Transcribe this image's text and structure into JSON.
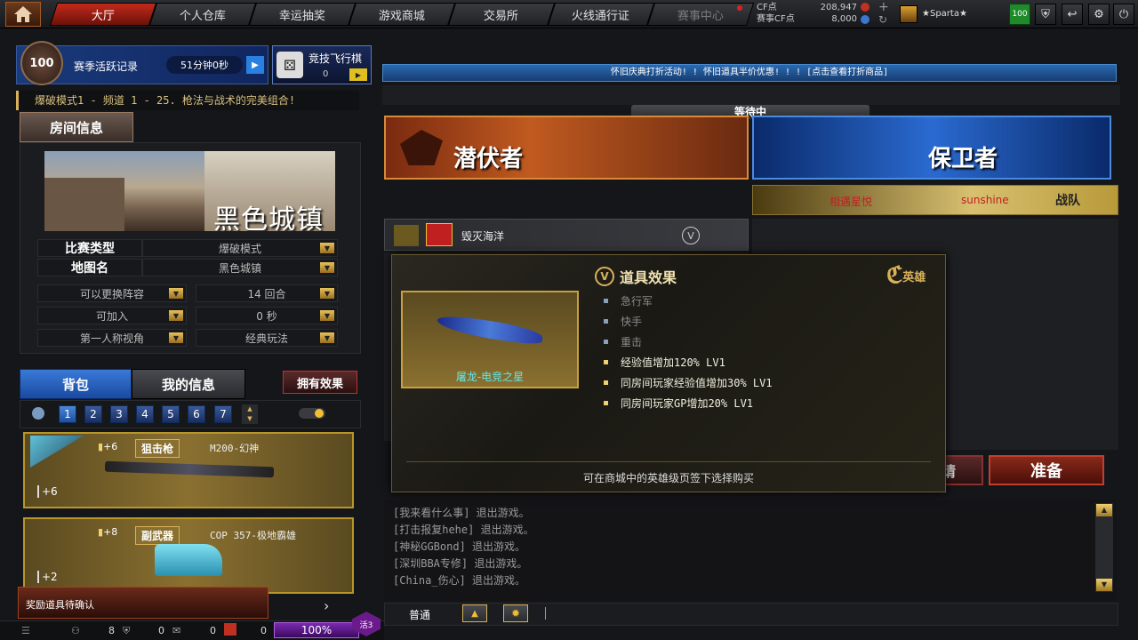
{
  "nav": {
    "tabs": [
      "大厅",
      "个人仓库",
      "幸运抽奖",
      "游戏商城",
      "交易所",
      "火线通行证",
      "赛事中心"
    ]
  },
  "currency": {
    "cf_label": "CF点",
    "cf_value": "208,947",
    "race_label": "赛事CF点",
    "race_value": "8,000"
  },
  "player": {
    "name": "★Sparta★",
    "level": "100"
  },
  "season": {
    "rank": "100",
    "title": "赛季活跃记录",
    "time": "51分钟0秒",
    "chess_title": "竞技飞行棋",
    "chess_count": "0"
  },
  "marquee_left": "爆破模式1 - 频道 1 - 25. 枪法与战术的完美组合!",
  "marquee_right": "怀旧庆典打折活动! ! 怀旧道具半价优惠! ! ! [点击查看打折商品]",
  "room": {
    "header": "房间信息",
    "map_name_overlay": "黑色城镇",
    "match_type_label": "比赛类型",
    "match_type_value": "爆破模式",
    "map_label": "地图名",
    "map_value": "黑色城镇",
    "opt1": "可以更换阵容",
    "opt2": "14 回合",
    "opt3": "可加入",
    "opt4": "0 秒",
    "opt5": "第一人称视角",
    "opt6": "经典玩法"
  },
  "bag": {
    "tab_bag": "背包",
    "tab_info": "我的信息",
    "effect_btn": "拥有效果",
    "pages": [
      "1",
      "2",
      "3",
      "4",
      "5",
      "6",
      "7"
    ],
    "items": [
      {
        "bullet": "+6",
        "category": "狙击枪",
        "name": "M200-幻神",
        "bonus": "+6"
      },
      {
        "bullet": "+8",
        "category": "副武器",
        "name": "COP 357-极地霸雄",
        "bonus": "+2"
      }
    ]
  },
  "reward": "奖励道具待确认",
  "bottom": {
    "count1": "8",
    "count2": "0",
    "count3": "0",
    "count4": "0",
    "progress": "100%",
    "active": "活3"
  },
  "match": {
    "status": "等待中",
    "team1": "潜伏者",
    "team2": "保卫者",
    "clan_player1": "相遇星悦",
    "clan_player2": "sunshine",
    "clan_tag": "战队",
    "player1": "毁灭海洋"
  },
  "tooltip": {
    "title": "道具效果",
    "hero": "英雄",
    "item_name": "屠龙-电竞之星",
    "effects_gray": [
      "急行军",
      "快手",
      "重击"
    ],
    "effects": [
      "经验值增加120% LV1",
      "同房间玩家经验值增加30% LV1",
      "同房间玩家GP增加20% LV1"
    ],
    "footer": "可在商城中的英雄级页签下选择购买"
  },
  "buttons": {
    "ready": "准备",
    "other": "邀请"
  },
  "chat": {
    "lines": [
      "[我来看什么事] 退出游戏。",
      "[打击报复hehe] 退出游戏。",
      "[神秘GGBond] 退出游戏。",
      "[深圳BBA专修] 退出游戏。",
      "[China_伤心] 退出游戏。"
    ],
    "channel": "普通"
  },
  "colors": {
    "accent_red": "#c22a1a",
    "accent_blue": "#2a5fb4",
    "gold": "#d8b25a"
  }
}
